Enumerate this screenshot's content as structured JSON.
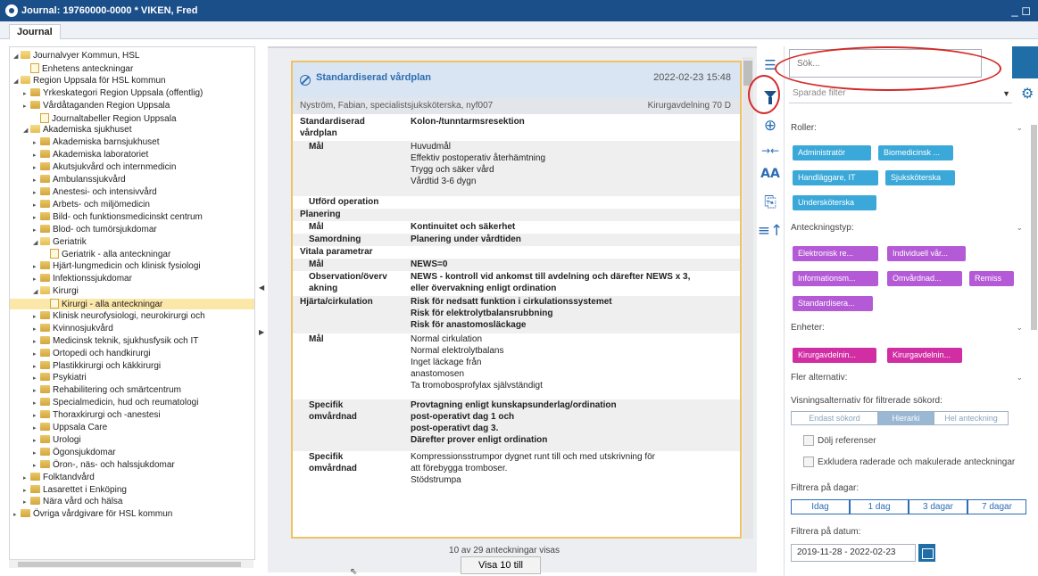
{
  "window": {
    "title": "Journal: 19760000-0000 * VIKEN, Fred",
    "controls": "_ ◻"
  },
  "tab": "Journal",
  "tree": [
    {
      "label": "Journalvyer Kommun, HSL",
      "exp": "◢",
      "icon": "folder-open"
    },
    {
      "label": "Enhetens anteckningar",
      "exp": "",
      "icon": "doc"
    },
    {
      "label": "Region Uppsala för HSL kommun",
      "exp": "◢",
      "icon": "folder-open"
    },
    {
      "label": "Yrkeskategori Region Uppsala (offentlig)",
      "exp": "▸",
      "icon": "folder"
    },
    {
      "label": "Vårdåtaganden Region Uppsala",
      "exp": "▸",
      "icon": "folder"
    },
    {
      "label": "Journaltabeller Region Uppsala",
      "exp": "",
      "icon": "doc"
    },
    {
      "label": "Akademiska sjukhuset",
      "exp": "◢",
      "icon": "folder-open"
    },
    {
      "label": "Akademiska barnsjukhuset",
      "exp": "▸",
      "icon": "folder"
    },
    {
      "label": "Akademiska laboratoriet",
      "exp": "▸",
      "icon": "folder"
    },
    {
      "label": "Akutsjukvård och internmedicin",
      "exp": "▸",
      "icon": "folder"
    },
    {
      "label": "Ambulanssjukvård",
      "exp": "▸",
      "icon": "folder"
    },
    {
      "label": "Anestesi- och intensivvård",
      "exp": "▸",
      "icon": "folder"
    },
    {
      "label": "Arbets- och miljömedicin",
      "exp": "▸",
      "icon": "folder"
    },
    {
      "label": "Bild- och funktionsmedicinskt centrum",
      "exp": "▸",
      "icon": "folder"
    },
    {
      "label": "Blod- och tumörsjukdomar",
      "exp": "▸",
      "icon": "folder"
    },
    {
      "label": "Geriatrik",
      "exp": "◢",
      "icon": "folder-open"
    },
    {
      "label": "Geriatrik - alla anteckningar",
      "exp": "",
      "icon": "doc"
    },
    {
      "label": "Hjärt-lungmedicin och klinisk fysiologi",
      "exp": "▸",
      "icon": "folder"
    },
    {
      "label": "Infektionssjukdomar",
      "exp": "▸",
      "icon": "folder"
    },
    {
      "label": "Kirurgi",
      "exp": "◢",
      "icon": "folder-open"
    },
    {
      "label": "Kirurgi - alla anteckningar",
      "exp": "",
      "icon": "doc",
      "selected": true
    },
    {
      "label": "Klinisk neurofysiologi, neurokirurgi och",
      "exp": "▸",
      "icon": "folder"
    },
    {
      "label": "Kvinnosjukvård",
      "exp": "▸",
      "icon": "folder"
    },
    {
      "label": "Medicinsk teknik, sjukhusfysik och IT",
      "exp": "▸",
      "icon": "folder"
    },
    {
      "label": "Ortopedi och handkirurgi",
      "exp": "▸",
      "icon": "folder"
    },
    {
      "label": "Plastikkirurgi och käkkirurgi",
      "exp": "▸",
      "icon": "folder"
    },
    {
      "label": "Psykiatri",
      "exp": "▸",
      "icon": "folder"
    },
    {
      "label": "Rehabilitering och smärtcentrum",
      "exp": "▸",
      "icon": "folder"
    },
    {
      "label": "Specialmedicin, hud och reumatologi",
      "exp": "▸",
      "icon": "folder"
    },
    {
      "label": "Thoraxkirurgi och -anestesi",
      "exp": "▸",
      "icon": "folder"
    },
    {
      "label": "Uppsala Care",
      "exp": "▸",
      "icon": "folder"
    },
    {
      "label": "Urologi",
      "exp": "▸",
      "icon": "folder"
    },
    {
      "label": "Ögonsjukdomar",
      "exp": "▸",
      "icon": "folder"
    },
    {
      "label": "Öron-, näs- och halssjukdomar",
      "exp": "▸",
      "icon": "folder"
    },
    {
      "label": "Folktandvård",
      "exp": "▸",
      "icon": "folder"
    },
    {
      "label": "Lasarettet i Enköping",
      "exp": "▸",
      "icon": "folder"
    },
    {
      "label": "Nära vård och hälsa",
      "exp": "▸",
      "icon": "folder"
    },
    {
      "label": "Övriga vårdgivare för HSL kommun",
      "exp": "▸",
      "icon": "folder"
    }
  ],
  "note": {
    "title": "Standardiserad vårdplan",
    "date": "2022-02-23 15:48",
    "author": "Nyström, Fabian, specialistsjuksköterska, nyf007",
    "unit": "Kirurgavdelning 70 D",
    "rows": [
      {
        "k": "Standardiserad\nvårdplan",
        "v": [
          "Kolon-/tunntarmsresektion"
        ],
        "bold": true,
        "indent": false
      },
      {
        "k": "Mål",
        "v": [
          "Huvudmål",
          "Effektiv postoperativ återhämtning",
          "Trygg och säker vård",
          "Vårdtid 3-6 dygn"
        ],
        "bold": false,
        "indent": true
      },
      {
        "k": "Utförd operation",
        "v": [
          ""
        ],
        "bold": true,
        "indent": true
      },
      {
        "k": "Planering",
        "v": [
          ""
        ],
        "bold": true,
        "indent": false
      },
      {
        "k": "Mål",
        "v": [
          "Kontinuitet och säkerhet"
        ],
        "bold": true,
        "indent": true
      },
      {
        "k": "Samordning",
        "v": [
          "Planering under vårdtiden"
        ],
        "bold": true,
        "indent": true
      },
      {
        "k": "Vitala parametrar",
        "v": [
          ""
        ],
        "bold": true,
        "indent": false
      },
      {
        "k": "Mål",
        "v": [
          "NEWS=0"
        ],
        "bold": true,
        "indent": true
      },
      {
        "k": "Observation/överv\nakning",
        "v": [
          "NEWS - kontroll vid ankomst till avdelning och därefter NEWS x 3,",
          "eller övervakning enligt ordination"
        ],
        "bold": true,
        "indent": true
      },
      {
        "k": "Hjärta/cirkulation",
        "v": [
          "Risk för nedsatt funktion i cirkulationssystemet",
          "Risk för elektrolytbalansrubbning",
          "Risk för anastomosläckage"
        ],
        "bold": true,
        "indent": false
      },
      {
        "k": "Mål",
        "v": [
          "Normal cirkulation",
          "Normal elektrolytbalans",
          "Inget läckage från",
          "anastomosen",
          "Ta tromobosprofylax självständigt"
        ],
        "bold": false,
        "indent": true
      },
      {
        "k": "Specifik\nomvårdnad",
        "v": [
          "Provtagning enligt kunskapsunderlag/ordination",
          "post-operativt dag 1 och",
          "post-operativt dag 3.",
          "Därefter prover enligt ordination"
        ],
        "bold": true,
        "indent": true
      },
      {
        "k": "Specifik\nomvårdnad",
        "v": [
          "Kompressionsstrumpor dygnet runt till och med utskrivning för",
          "att förebygga tromboser.",
          "Stödstrumpa"
        ],
        "bold": false,
        "indent": true
      }
    ]
  },
  "footer": {
    "count": "10 av 29 anteckningar visas",
    "show_more": "Visa 10 till"
  },
  "filter": {
    "search_placeholder": "Sök...",
    "saved_filter": "Sparade filter",
    "roles_title": "Roller:",
    "roles": [
      "Administratör",
      "Biomedicinsk ...",
      "Handläggare, IT",
      "Sjuksköterska",
      "Undersköterska"
    ],
    "notetype_title": "Anteckningstyp:",
    "notetypes": [
      "Elektronisk re...",
      "Individuell vår...",
      "Informationsm...",
      "Omvårdnad...",
      "Remiss",
      "Standardisera..."
    ],
    "units_title": "Enheter:",
    "units": [
      "Kirurgavdelnin...",
      "Kirurgavdelnin..."
    ],
    "more_title": "Fler alternativ:",
    "view_title": "Visningsalternativ för filtrerade sökord:",
    "view_options": [
      "Endast sökord",
      "Hierarki",
      "Hel anteckning"
    ],
    "hide_refs": "Dölj referenser",
    "exclude_deleted": "Exkludera raderade och makulerade anteckningar",
    "days_title": "Filtrera på dagar:",
    "days": [
      "Idag",
      "1 dag",
      "3 dagar",
      "7 dagar"
    ],
    "date_title": "Filtrera på datum:",
    "date_range": "2019-11-28 - 2022-02-23"
  },
  "colors": {
    "title_bar": "#1b4f8a",
    "accent": "#1f6ea8",
    "annotation": "#d42a2a",
    "chip_blue": "#3aa8d8",
    "chip_purple": "#b45ad6",
    "chip_magenta": "#d12ea3"
  }
}
